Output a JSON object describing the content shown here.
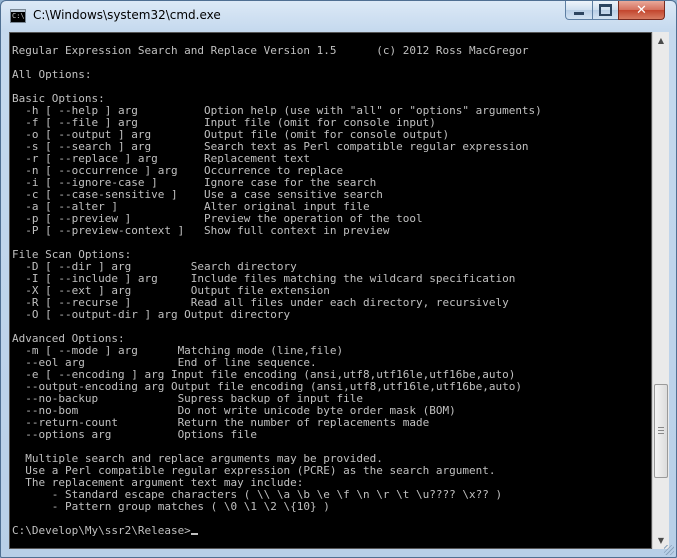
{
  "window": {
    "title": "C:\\Windows\\system32\\cmd.exe",
    "icon_name": "cmd-icon",
    "controls": {
      "minimize": "minimize-icon",
      "maximize": "maximize-icon",
      "close": "✕"
    },
    "colors": {
      "console_bg": "#000000",
      "console_fg": "#c0c0c0",
      "close_button": "#c3452d"
    }
  },
  "console": {
    "lines": [
      "Regular Expression Search and Replace Version 1.5      (c) 2012 Ross MacGregor",
      "",
      "All Options:",
      "",
      "Basic Options:",
      "  -h [ --help ] arg          Option help (use with \"all\" or \"options\" arguments)",
      "  -f [ --file ] arg          Input file (omit for console input)",
      "  -o [ --output ] arg        Output file (omit for console output)",
      "  -s [ --search ] arg        Search text as Perl compatible regular expression",
      "  -r [ --replace ] arg       Replacement text",
      "  -n [ --occurrence ] arg    Occurrence to replace",
      "  -i [ --ignore-case ]       Ignore case for the search",
      "  -c [ --case-sensitive ]    Use a case sensitive search",
      "  -a [ --alter ]             Alter original input file",
      "  -p [ --preview ]           Preview the operation of the tool",
      "  -P [ --preview-context ]   Show full context in preview",
      "",
      "File Scan Options:",
      "  -D [ --dir ] arg         Search directory",
      "  -I [ --include ] arg     Include files matching the wildcard specification",
      "  -X [ --ext ] arg         Output file extension",
      "  -R [ --recurse ]         Read all files under each directory, recursively",
      "  -O [ --output-dir ] arg Output directory",
      "",
      "Advanced Options:",
      "  -m [ --mode ] arg      Matching mode (line,file)",
      "  --eol arg              End of line sequence.",
      "  -e [ --encoding ] arg Input file encoding (ansi,utf8,utf16le,utf16be,auto)",
      "  --output-encoding arg Output file encoding (ansi,utf8,utf16le,utf16be,auto)",
      "  --no-backup            Supress backup of input file",
      "  --no-bom               Do not write unicode byte order mask (BOM)",
      "  --return-count         Return the number of replacements made",
      "  --options arg          Options file",
      "",
      "  Multiple search and replace arguments may be provided.",
      "  Use a Perl compatible regular expression (PCRE) as the search argument.",
      "  The replacement argument text may include:",
      "      - Standard escape characters ( \\\\ \\a \\b \\e \\f \\n \\r \\t \\u???? \\x?? )",
      "      - Pattern group matches ( \\0 \\1 \\2 \\{10} )",
      "",
      "C:\\Develop\\My\\ssr2\\Release>"
    ]
  },
  "scrollbar": {
    "up": "▲",
    "down": "▼",
    "position": 0.86
  }
}
